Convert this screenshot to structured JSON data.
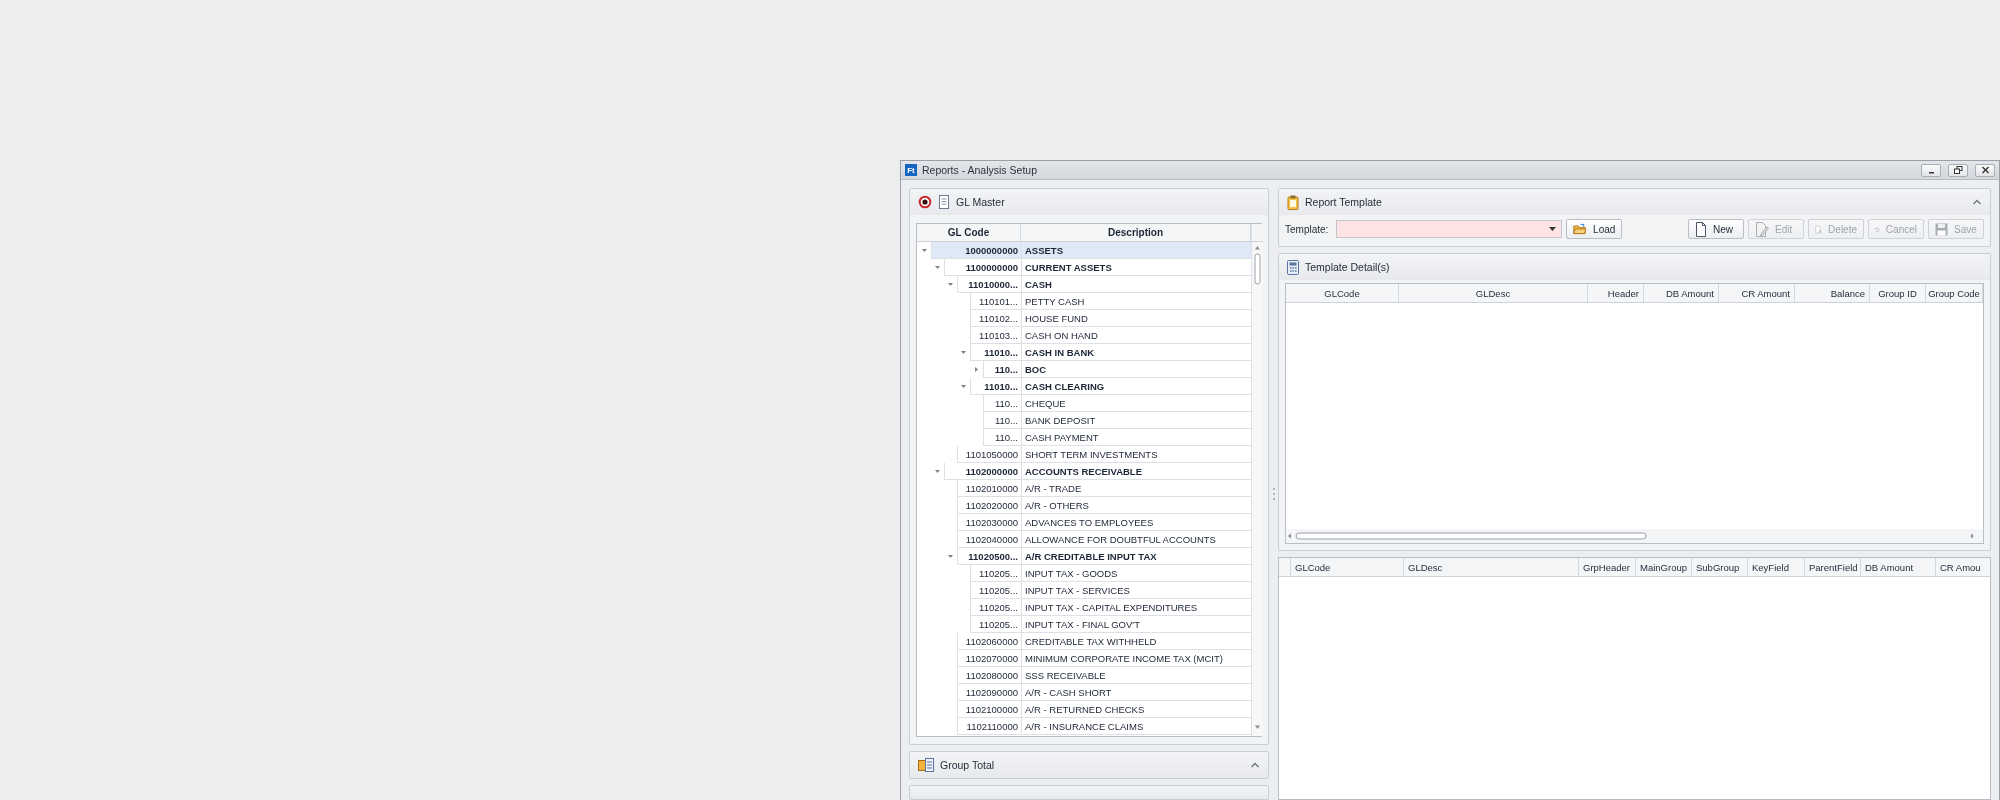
{
  "window": {
    "logo": "Ft",
    "title": "Reports - Analysis Setup"
  },
  "gl_master": {
    "title": "GL Master",
    "columns": [
      "GL Code",
      "Description"
    ],
    "rows": [
      {
        "code": "1000000000",
        "description": "ASSETS",
        "expanded": true,
        "selected": true,
        "children": [
          {
            "code": "1100000000",
            "description": "CURRENT ASSETS",
            "expanded": true,
            "selected": false,
            "children": [
              {
                "code": "11010000...",
                "description": "CASH",
                "expanded": true,
                "selected": false,
                "children": [
                  {
                    "code": "110101...",
                    "description": "PETTY CASH",
                    "selected": false
                  },
                  {
                    "code": "110102...",
                    "description": "HOUSE FUND",
                    "selected": false
                  },
                  {
                    "code": "110103...",
                    "description": "CASH ON HAND",
                    "selected": false
                  },
                  {
                    "code": "11010...",
                    "description": "CASH IN BANK",
                    "expanded": true,
                    "selected": false,
                    "children": [
                      {
                        "code": "110...",
                        "description": "BOC",
                        "expanded": false,
                        "selected": false
                      }
                    ]
                  },
                  {
                    "code": "11010...",
                    "description": "CASH CLEARING",
                    "expanded": true,
                    "selected": false,
                    "children": [
                      {
                        "code": "110...",
                        "description": "CHEQUE",
                        "selected": false
                      },
                      {
                        "code": "110...",
                        "description": "BANK DEPOSIT",
                        "selected": false
                      },
                      {
                        "code": "110...",
                        "description": "CASH PAYMENT",
                        "selected": false
                      }
                    ]
                  }
                ]
              },
              {
                "code": "1101050000",
                "description": "SHORT TERM INVESTMENTS",
                "selected": false
              }
            ]
          },
          {
            "code": "1102000000",
            "description": "ACCOUNTS RECEIVABLE",
            "expanded": true,
            "selected": false,
            "children": [
              {
                "code": "1102010000",
                "description": "A/R - TRADE",
                "selected": false
              },
              {
                "code": "1102020000",
                "description": "A/R - OTHERS",
                "selected": false
              },
              {
                "code": "1102030000",
                "description": "ADVANCES TO EMPLOYEES",
                "selected": false
              },
              {
                "code": "1102040000",
                "description": "ALLOWANCE FOR DOUBTFUL ACCOUNTS",
                "selected": false
              },
              {
                "code": "11020500...",
                "description": "A/R CREDITABLE INPUT TAX",
                "expanded": true,
                "selected": false,
                "children": [
                  {
                    "code": "110205...",
                    "description": "INPUT TAX - GOODS",
                    "selected": false
                  },
                  {
                    "code": "110205...",
                    "description": "INPUT TAX - SERVICES",
                    "selected": false
                  },
                  {
                    "code": "110205...",
                    "description": "INPUT TAX - CAPITAL EXPENDITURES",
                    "selected": false
                  },
                  {
                    "code": "110205...",
                    "description": "INPUT TAX - FINAL GOV'T",
                    "selected": false
                  }
                ]
              },
              {
                "code": "1102060000",
                "description": "CREDITABLE TAX WITHHELD",
                "selected": false
              },
              {
                "code": "1102070000",
                "description": "MINIMUM CORPORATE INCOME TAX (MCIT)",
                "selected": false
              },
              {
                "code": "1102080000",
                "description": "SSS RECEIVABLE",
                "selected": false
              },
              {
                "code": "1102090000",
                "description": "A/R - CASH SHORT",
                "selected": false
              },
              {
                "code": "1102100000",
                "description": "A/R - RETURNED CHECKS",
                "selected": false
              },
              {
                "code": "1102110000",
                "description": "A/R - INSURANCE CLAIMS",
                "selected": false
              }
            ]
          }
        ]
      }
    ]
  },
  "group_total": {
    "title": "Group Total"
  },
  "report_template": {
    "title": "Report Template",
    "template_label": "Template:",
    "template_field": {
      "required": true
    },
    "load_button": "Load",
    "buttons": [
      {
        "kind": "new",
        "label": "New",
        "disabled": false
      },
      {
        "kind": "edit",
        "label": "Edit",
        "disabled": true
      },
      {
        "kind": "delete",
        "label": "Delete",
        "disabled": true
      },
      {
        "kind": "cancel",
        "label": "Cancel",
        "disabled": true
      },
      {
        "kind": "save",
        "label": "Save",
        "disabled": true
      }
    ]
  },
  "template_details": {
    "title": "Template Detail(s)",
    "columns": [
      "GLCode",
      "GLDesc",
      "Header",
      "DB Amount",
      "CR Amount",
      "Balance",
      "Group ID",
      "Group Code"
    ]
  },
  "detail_grid": {
    "columns": [
      "GLCode",
      "GLDesc",
      "GrpHeader",
      "MainGroup",
      "SubGroup",
      "KeyField",
      "ParentField",
      "DB Amount",
      "CR Amou"
    ]
  }
}
